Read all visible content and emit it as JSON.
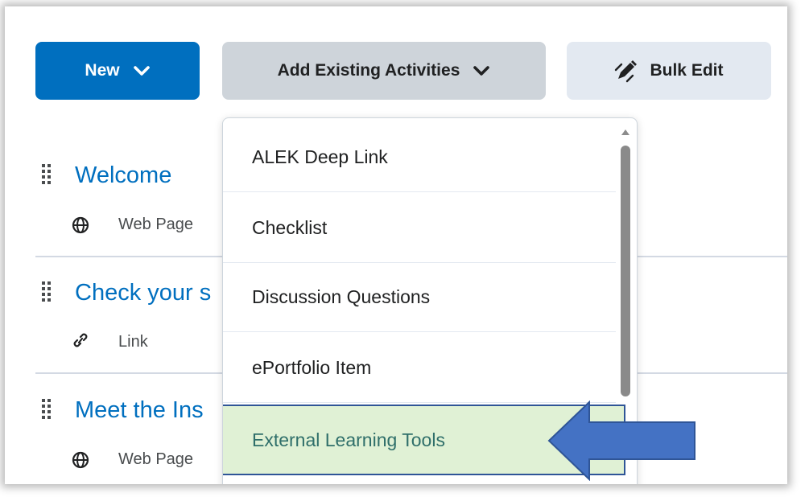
{
  "toolbar": {
    "new_label": "New",
    "add_existing_label": "Add Existing Activities",
    "bulk_edit_label": "Bulk Edit"
  },
  "content": {
    "items": [
      {
        "title": "Welcome",
        "type": "Web Page",
        "icon": "globe-icon"
      },
      {
        "title": "Check your s",
        "type": "Link",
        "icon": "link-icon"
      },
      {
        "title": "Meet the Ins",
        "type": "Web Page",
        "icon": "globe-icon"
      }
    ]
  },
  "dropdown": {
    "items": [
      {
        "label": "ALEK Deep Link"
      },
      {
        "label": "Checklist"
      },
      {
        "label": "Discussion Questions"
      },
      {
        "label": "ePortfolio Item"
      },
      {
        "label": "External Learning Tools",
        "highlighted": true
      }
    ]
  },
  "colors": {
    "primary": "#006fbf",
    "add_button_bg": "#ced4da",
    "bulk_button_bg": "#e3e9f1",
    "highlight_bg": "#e0f1d5",
    "highlight_border": "#2f5597",
    "arrow": "#4472c4"
  }
}
